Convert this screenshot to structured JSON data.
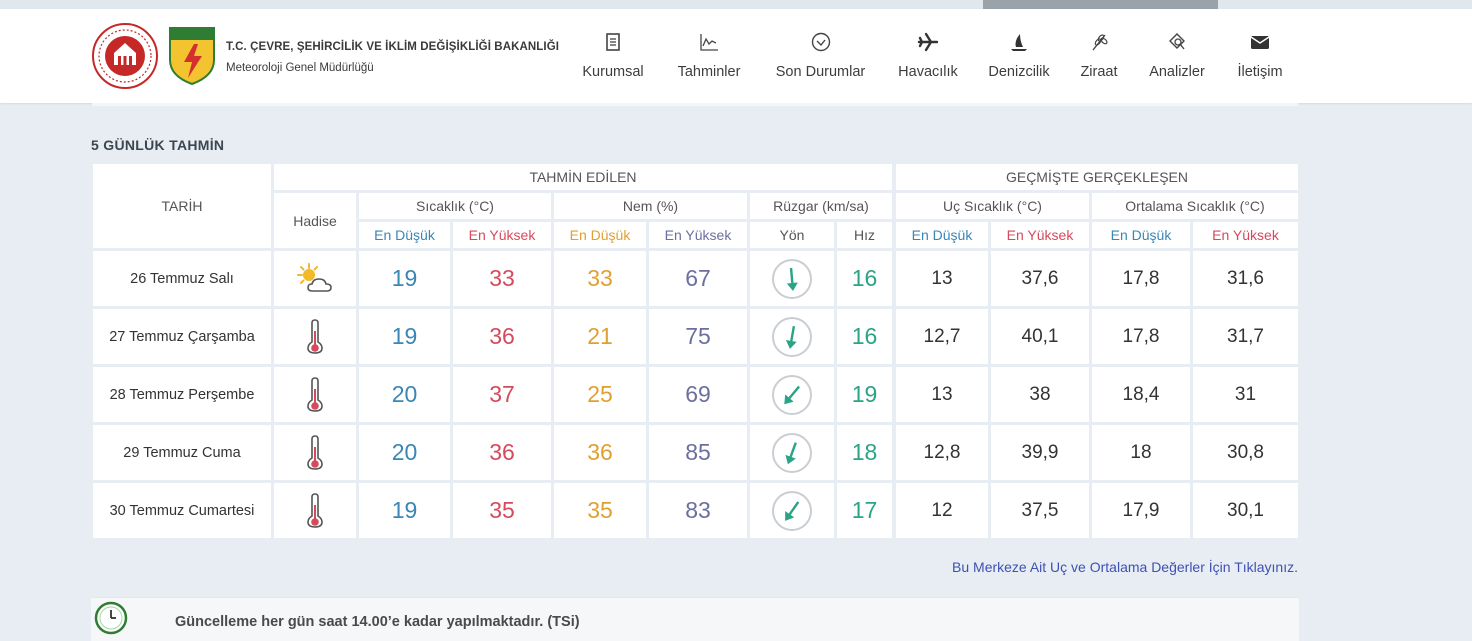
{
  "header": {
    "ministry": "T.C. ÇEVRE, ŞEHİRCİLİK VE İKLİM DEĞİŞİKLİĞİ BAKANLIĞI",
    "directorate": "Meteoroloji Genel Müdürlüğü",
    "logo_text": "METEOROLOJİ"
  },
  "nav": [
    {
      "label": "Kurumsal",
      "icon": "document-icon"
    },
    {
      "label": "Tahminler",
      "icon": "chart-icon"
    },
    {
      "label": "Son Durumlar",
      "icon": "circle-check-icon"
    },
    {
      "label": "Havacılık",
      "icon": "plane-icon"
    },
    {
      "label": "Denizcilik",
      "icon": "ship-icon"
    },
    {
      "label": "Ziraat",
      "icon": "wheat-icon"
    },
    {
      "label": "Analizler",
      "icon": "search-icon"
    },
    {
      "label": "İletişim",
      "icon": "envelope-icon"
    }
  ],
  "section_title": "5 GÜNLÜK TAHMİN",
  "table": {
    "group_forecast": "TAHMİN EDİLEN",
    "group_past": "GEÇMİŞTE GERÇEKLEŞEN",
    "col_date": "TARİH",
    "col_event": "Hadise",
    "col_temp": "Sıcaklık (°C)",
    "col_humidity": "Nem (%)",
    "col_wind": "Rüzgar (km/sa)",
    "col_extreme_temp": "Uç Sıcaklık (°C)",
    "col_avg_temp": "Ortalama Sıcaklık (°C)",
    "sub_low": "En Düşük",
    "sub_high": "En Yüksek",
    "sub_direction": "Yön",
    "sub_speed": "Hız",
    "rows": [
      {
        "date": "26 Temmuz Salı",
        "icon": "partly-cloudy-icon",
        "t_low": "19",
        "t_high": "33",
        "h_low": "33",
        "h_high": "67",
        "wind_dir": 175,
        "wind_speed": "16",
        "ext_low": "13",
        "ext_high": "37,6",
        "avg_low": "17,8",
        "avg_high": "31,6"
      },
      {
        "date": "27 Temmuz Çarşamba",
        "icon": "thermometer-icon",
        "t_low": "19",
        "t_high": "36",
        "h_low": "21",
        "h_high": "75",
        "wind_dir": 190,
        "wind_speed": "16",
        "ext_low": "12,7",
        "ext_high": "40,1",
        "avg_low": "17,8",
        "avg_high": "31,7"
      },
      {
        "date": "28 Temmuz Perşembe",
        "icon": "thermometer-icon",
        "t_low": "20",
        "t_high": "37",
        "h_low": "25",
        "h_high": "69",
        "wind_dir": 220,
        "wind_speed": "19",
        "ext_low": "13",
        "ext_high": "38",
        "avg_low": "18,4",
        "avg_high": "31"
      },
      {
        "date": "29 Temmuz Cuma",
        "icon": "thermometer-icon",
        "t_low": "20",
        "t_high": "36",
        "h_low": "36",
        "h_high": "85",
        "wind_dir": 200,
        "wind_speed": "18",
        "ext_low": "12,8",
        "ext_high": "39,9",
        "avg_low": "18",
        "avg_high": "30,8"
      },
      {
        "date": "30 Temmuz Cumartesi",
        "icon": "thermometer-icon",
        "t_low": "19",
        "t_high": "35",
        "h_low": "35",
        "h_high": "83",
        "wind_dir": 215,
        "wind_speed": "17",
        "ext_low": "12",
        "ext_high": "37,5",
        "avg_low": "17,9",
        "avg_high": "30,1"
      }
    ]
  },
  "link_text": "Bu Merkeze Ait Uç ve Ortalama Değerler İçin Tıklayınız.",
  "notice_text": "Güncelleme her gün saat 14.00’e kadar yapılmaktadır. (TSi)",
  "colors": {
    "blue": "#3a86b5",
    "red": "#d54a5c",
    "orange": "#e0a030",
    "purple": "#6b6f9e",
    "teal": "#2aa486"
  }
}
